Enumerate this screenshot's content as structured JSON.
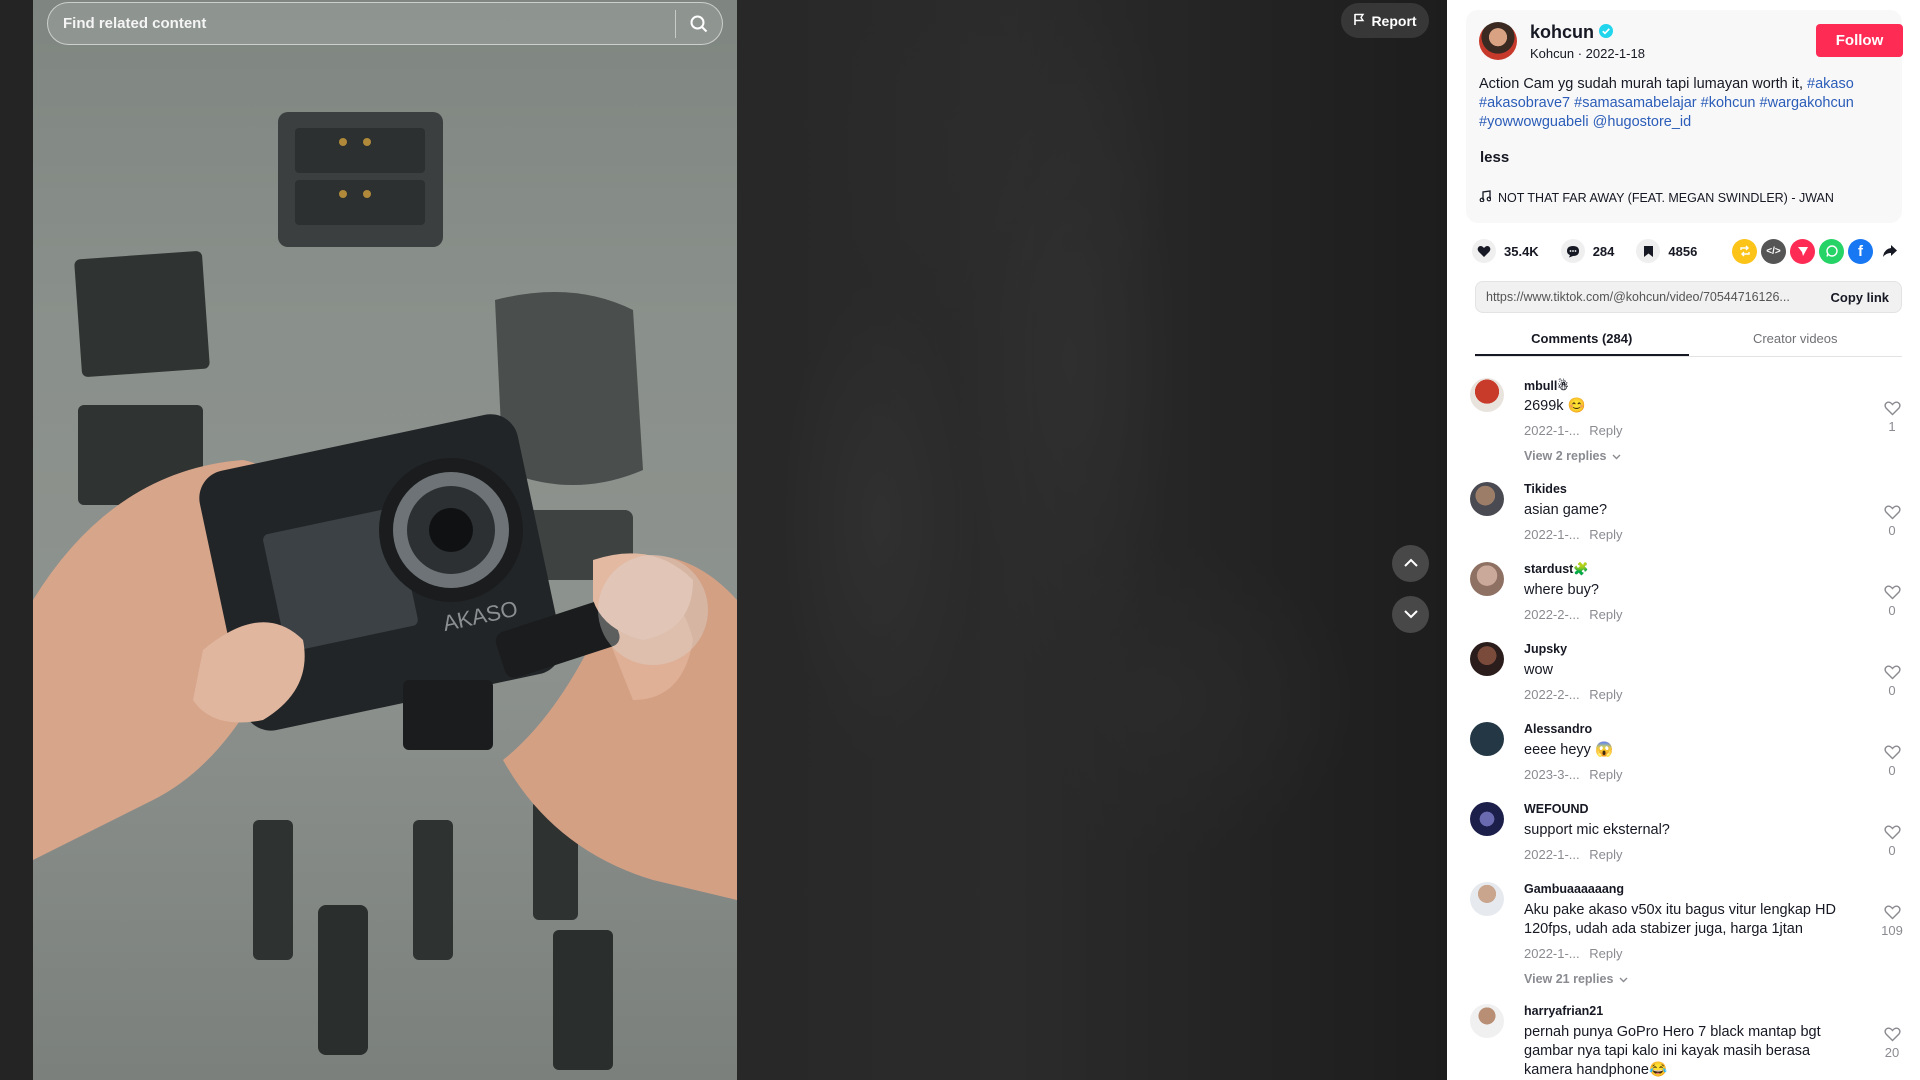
{
  "search": {
    "placeholder": "Find related content"
  },
  "report_label": "Report",
  "author": {
    "username": "kohcun",
    "nickname": "Kohcun",
    "date": "2022-1-18",
    "follow_label": "Follow"
  },
  "description": {
    "text": "Action Cam yg sudah murah tapi lumayan worth it,",
    "tags": [
      "#akaso",
      "#akasobrave7",
      "#samasamabelajar",
      "#kohcun",
      "#wargakohcun",
      "#yowwowguabeli",
      "@hugostore_id"
    ]
  },
  "less_label": "less",
  "music": "NOT THAT FAR AWAY (FEAT. MEGAN SWINDLER) - JWAN",
  "stats": {
    "likes": "35.4K",
    "comments": "284",
    "saves": "4856"
  },
  "share_icons": [
    "repost-icon",
    "embed-icon",
    "send-icon",
    "whatsapp-icon",
    "facebook-icon",
    "share-arrow-icon"
  ],
  "link": {
    "url": "https://www.tiktok.com/@kohcun/video/70544716126...",
    "copy_label": "Copy link"
  },
  "tabs": [
    {
      "label": "Comments (284)"
    },
    {
      "label": "Creator videos"
    }
  ],
  "comments": [
    {
      "name": "mbull☃",
      "text": "2699k 😊",
      "date": "2022-1-...",
      "reply": "Reply",
      "likes": "1",
      "replies": "View 2 replies"
    },
    {
      "name": "Tikides",
      "text": "asian game?",
      "date": "2022-1-...",
      "reply": "Reply",
      "likes": "0"
    },
    {
      "name": "stardust🧩",
      "text": "where buy?",
      "date": "2022-2-...",
      "reply": "Reply",
      "likes": "0"
    },
    {
      "name": "Jupsky",
      "text": "wow",
      "date": "2022-2-...",
      "reply": "Reply",
      "likes": "0"
    },
    {
      "name": "Alessandro",
      "text": "eeee heyy 😱",
      "date": "2023-3-...",
      "reply": "Reply",
      "likes": "0"
    },
    {
      "name": "WEFOUND",
      "text": "support mic eksternal?",
      "date": "2022-1-...",
      "reply": "Reply",
      "likes": "0"
    },
    {
      "name": "Gambuaaaaaang",
      "text": "Aku pake akaso v50x itu bagus vitur lengkap HD 120fps, udah ada stabizer juga, harga 1jtan",
      "date": "2022-1-...",
      "reply": "Reply",
      "likes": "109",
      "replies": "View 21 replies"
    },
    {
      "name": "harryafrian21",
      "text": "pernah punya GoPro Hero 7 black mantap bgt gambar nya tapi kalo ini kayak masih berasa kamera handphone😂",
      "likes": "20"
    }
  ],
  "colors": {
    "accent": "#fe2c55",
    "link": "#2b5db9",
    "panel_bg": "#f8f8f8"
  }
}
